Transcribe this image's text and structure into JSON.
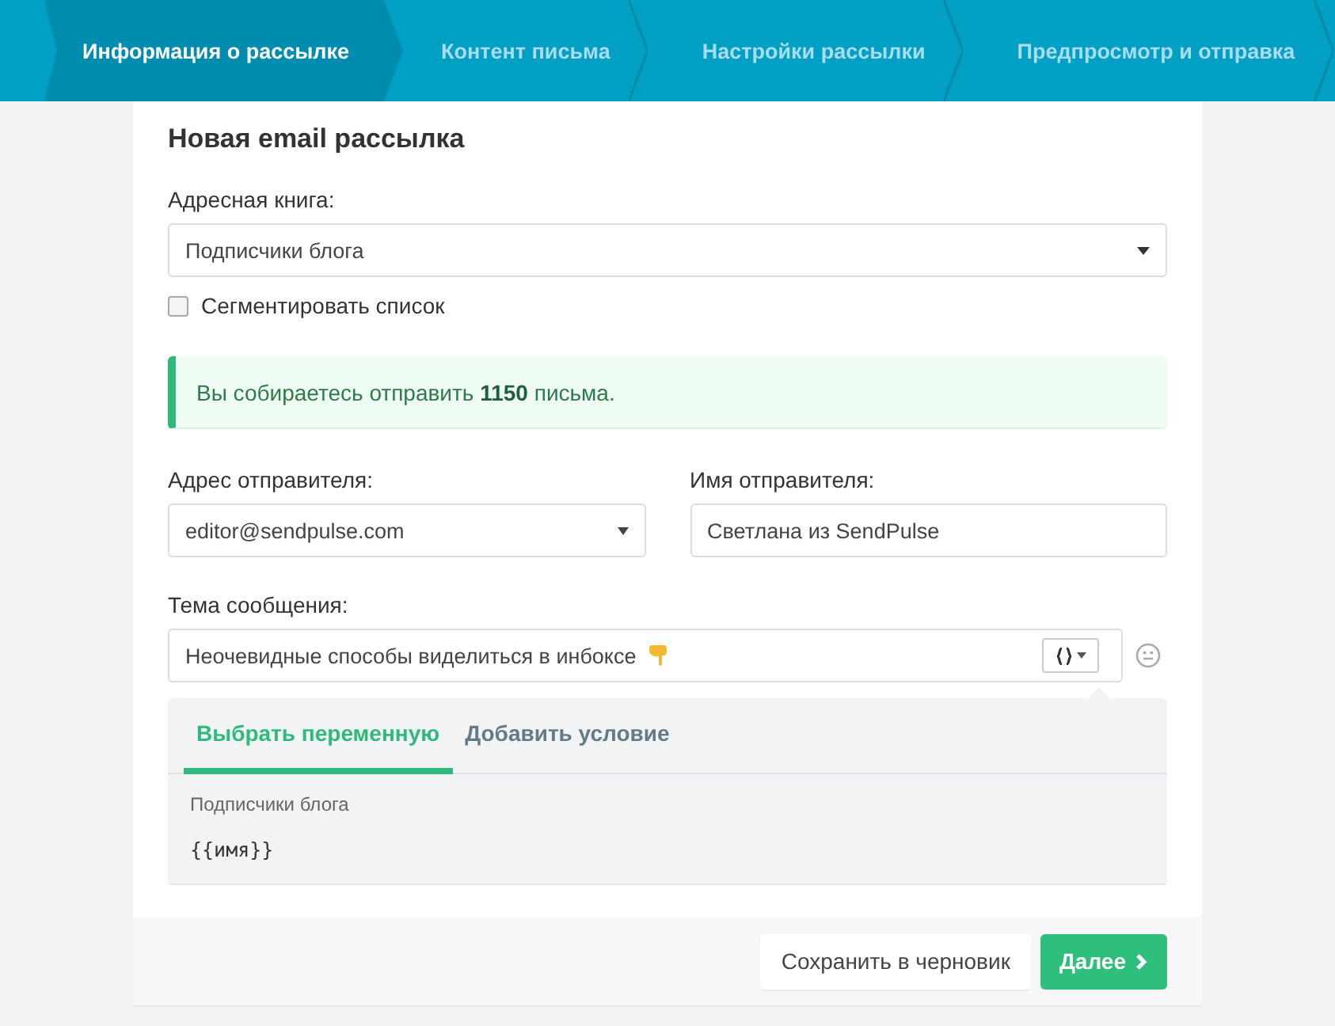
{
  "steps": [
    {
      "label": "Информация о рассылке",
      "selected": true
    },
    {
      "label": "Контент письма",
      "selected": false
    },
    {
      "label": "Настройки рассылки",
      "selected": false
    },
    {
      "label": "Предпросмотр и отправка",
      "selected": false
    }
  ],
  "title": "Новая email рассылка",
  "address_book": {
    "label": "Адресная книга:",
    "value": "Подписчики блога"
  },
  "segment": {
    "label": "Сегментировать список",
    "checked": false
  },
  "notice": {
    "text": "Вы собираетесь отправить **1150** письма."
  },
  "sender_address": {
    "label": "Адрес отправителя:",
    "value": "editor@sendpulse.com"
  },
  "sender_name": {
    "label": "Имя отправителя:",
    "value": "Светлана из SendPulse"
  },
  "subject": {
    "label": "Тема сообщения:",
    "value": "Неочевидные способы виделиться в инбоксе"
  },
  "variable_panel": {
    "tabs": [
      {
        "label": "Выбрать переменную",
        "selected": true
      },
      {
        "label": "Добавить условие",
        "selected": false
      }
    ],
    "list_name": "Подписчики блога",
    "variable": "{{имя}}"
  },
  "buttons": {
    "save_draft": "Сохранить в черновик",
    "next": "Далее"
  }
}
